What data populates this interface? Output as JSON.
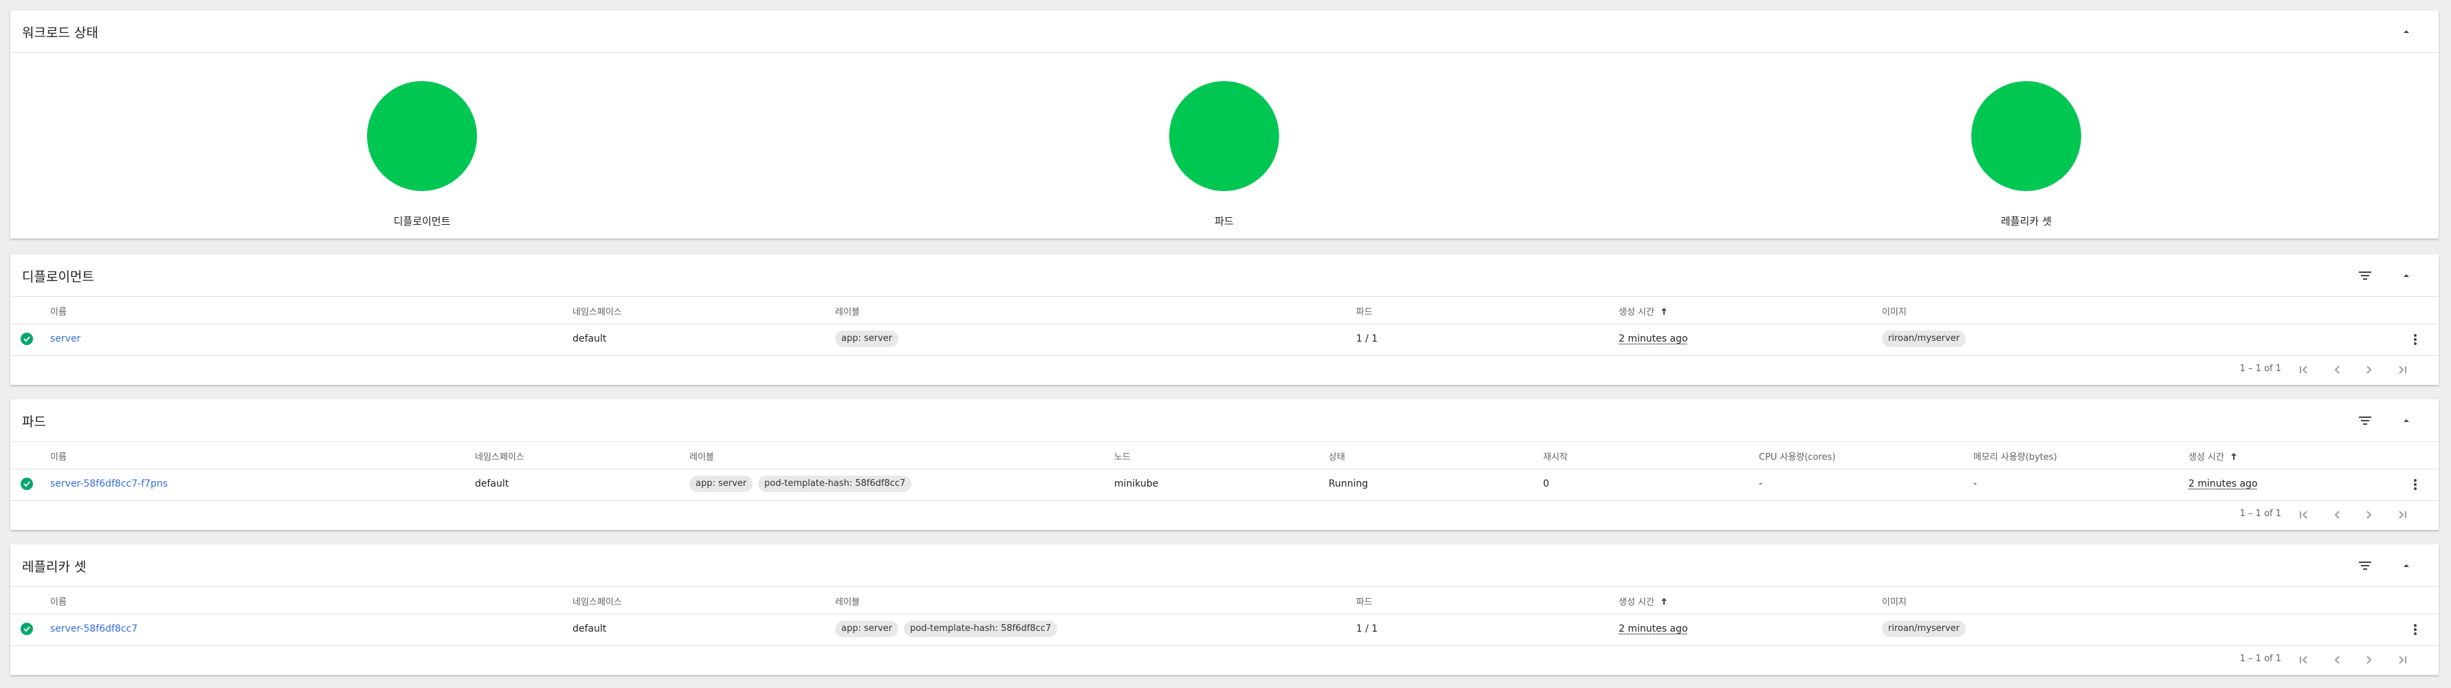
{
  "workload_status": {
    "title": "워크로드 상태",
    "color": "#00c752",
    "items": [
      {
        "label": "디플로이먼트"
      },
      {
        "label": "파드"
      },
      {
        "label": "레플리카 셋"
      }
    ]
  },
  "deployments": {
    "title": "디플로이먼트",
    "columns": [
      "이름",
      "네임스페이스",
      "레이블",
      "파드",
      "생성 시간",
      "이미지"
    ],
    "sort_icon": "arrow-up-icon",
    "rows": [
      {
        "name": "server",
        "namespace": "default",
        "labels": [
          "app: server"
        ],
        "pods": "1 / 1",
        "created": "2 minutes ago",
        "image": "riroan/myserver"
      }
    ],
    "pagination": "1 – 1 of 1"
  },
  "pods": {
    "title": "파드",
    "columns": [
      "이름",
      "네임스페이스",
      "레이블",
      "노드",
      "상태",
      "재시작",
      "CPU 사용량(cores)",
      "메모리 사용량(bytes)",
      "생성 시간"
    ],
    "sort_icon": "arrow-up-icon",
    "rows": [
      {
        "name": "server-58f6df8cc7-f7pns",
        "namespace": "default",
        "labels": [
          "app: server",
          "pod-template-hash: 58f6df8cc7"
        ],
        "node": "minikube",
        "status": "Running",
        "restarts": "0",
        "cpu": "-",
        "memory": "-",
        "created": "2 minutes ago"
      }
    ],
    "pagination": "1 – 1 of 1"
  },
  "replicasets": {
    "title": "레플리카 셋",
    "columns": [
      "이름",
      "네임스페이스",
      "레이블",
      "파드",
      "생성 시간",
      "이미지"
    ],
    "sort_icon": "arrow-up-icon",
    "rows": [
      {
        "name": "server-58f6df8cc7",
        "namespace": "default",
        "labels": [
          "app: server",
          "pod-template-hash: 58f6df8cc7"
        ],
        "pods": "1 / 1",
        "created": "2 minutes ago",
        "image": "riroan/myserver"
      }
    ],
    "pagination": "1 – 1 of 1"
  },
  "colors": {
    "link": "#326de6",
    "status_ok": "#00a86b",
    "background": "#eeeeee"
  }
}
